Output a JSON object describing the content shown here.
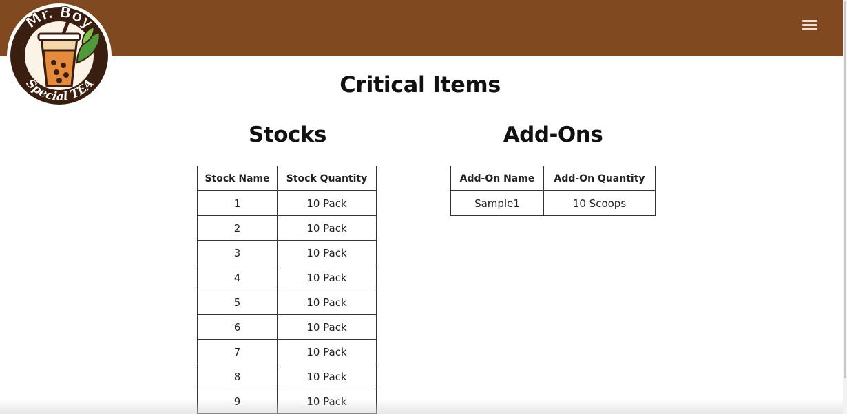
{
  "header": {
    "menu_icon": "hamburger-menu-icon",
    "background_color": "#804920"
  },
  "logo": {
    "top_text": "Mr. Boy",
    "bottom_text": "Special TEA"
  },
  "page": {
    "title": "Critical Items"
  },
  "stocks": {
    "title": "Stocks",
    "headers": [
      "Stock Name",
      "Stock Quantity"
    ],
    "rows": [
      {
        "name": "1",
        "quantity": "10 Pack"
      },
      {
        "name": "2",
        "quantity": "10 Pack"
      },
      {
        "name": "3",
        "quantity": "10 Pack"
      },
      {
        "name": "4",
        "quantity": "10 Pack"
      },
      {
        "name": "5",
        "quantity": "10 Pack"
      },
      {
        "name": "6",
        "quantity": "10 Pack"
      },
      {
        "name": "7",
        "quantity": "10 Pack"
      },
      {
        "name": "8",
        "quantity": "10 Pack"
      },
      {
        "name": "9",
        "quantity": "10 Pack"
      }
    ]
  },
  "addons": {
    "title": "Add-Ons",
    "headers": [
      "Add-On Name",
      "Add-On Quantity"
    ],
    "rows": [
      {
        "name": "Sample1",
        "quantity": "10 Scoops"
      }
    ]
  }
}
